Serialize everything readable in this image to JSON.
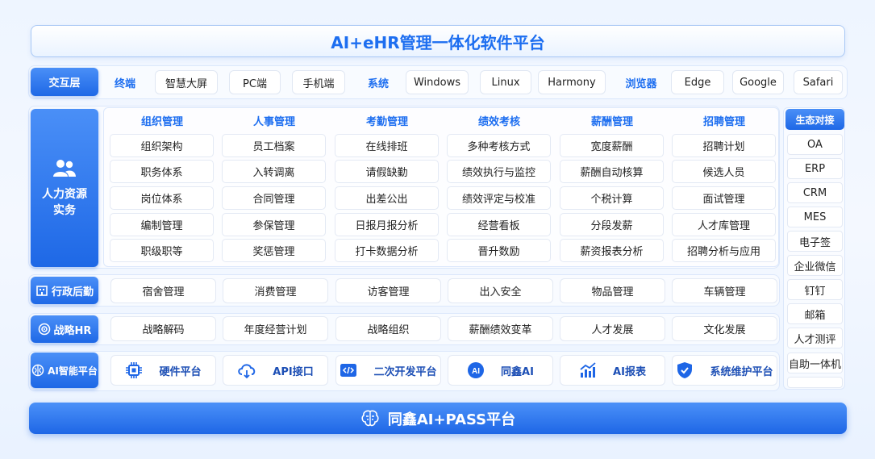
{
  "title": "AI+eHR管理一体化软件平台",
  "interaction": {
    "label": "交互层",
    "items": [
      {
        "text": "终端",
        "header": true
      },
      {
        "text": "智慧大屏"
      },
      {
        "text": "PC端"
      },
      {
        "text": "手机端"
      },
      {
        "text": "系统",
        "header": true
      },
      {
        "text": "Windows"
      },
      {
        "text": "Linux"
      },
      {
        "text": "Harmony"
      },
      {
        "text": "浏览器",
        "header": true
      },
      {
        "text": "Edge"
      },
      {
        "text": "Google"
      },
      {
        "text": "Safari"
      }
    ]
  },
  "hr": {
    "label_line1": "人力资源",
    "label_line2": "实务",
    "icon": "users-icon",
    "columns": [
      {
        "head": "组织管理",
        "items": [
          "组织架构",
          "职务体系",
          "岗位体系",
          "编制管理",
          "职级职等"
        ]
      },
      {
        "head": "人事管理",
        "items": [
          "员工档案",
          "入转调离",
          "合同管理",
          "参保管理",
          "奖惩管理"
        ]
      },
      {
        "head": "考勤管理",
        "items": [
          "在线排班",
          "请假缺勤",
          "出差公出",
          "日报月报分析",
          "打卡数据分析"
        ]
      },
      {
        "head": "绩效考核",
        "items": [
          "多种考核方式",
          "绩效执行与监控",
          "绩效评定与校准",
          "经营看板",
          "晋升数励"
        ]
      },
      {
        "head": "薪酬管理",
        "items": [
          "宽度薪酬",
          "薪酬自动核算",
          "个税计算",
          "分段发薪",
          "薪资报表分析"
        ]
      },
      {
        "head": "招聘管理",
        "items": [
          "招聘计划",
          "候选人员",
          "面试管理",
          "人才库管理",
          "招聘分析与应用"
        ]
      }
    ]
  },
  "admin": {
    "label": "行政后勤",
    "icon": "building-icon",
    "items": [
      "宿舍管理",
      "消费管理",
      "访客管理",
      "出入安全",
      "物品管理",
      "车辆管理"
    ]
  },
  "strategy": {
    "label": "战略HR",
    "icon": "target-icon",
    "items": [
      "战略解码",
      "年度经营计划",
      "战略组织",
      "薪酬绩效变革",
      "人才发展",
      "文化发展"
    ]
  },
  "ai": {
    "label": "AI智能平台",
    "icon": "ai-brain-icon",
    "items": [
      {
        "text": "硬件平台",
        "icon": "chip-icon"
      },
      {
        "text": "API接口",
        "icon": "cloud-api-icon"
      },
      {
        "text": "二次开发平台",
        "icon": "code-icon"
      },
      {
        "text": "同鑫AI",
        "icon": "ai-badge-icon"
      },
      {
        "text": "AI报表",
        "icon": "chart-icon"
      },
      {
        "text": "系统维护平台",
        "icon": "shield-icon"
      }
    ]
  },
  "ecosystem": {
    "head": "生态对接",
    "items": [
      "OA",
      "ERP",
      "CRM",
      "MES",
      "电子签",
      "企业微信",
      "钉钉",
      "邮箱",
      "人才测评",
      "自助一体机"
    ]
  },
  "footer": {
    "text": "同鑫AI+PASS平台",
    "icon": "brain-icon"
  },
  "colors": {
    "accent": "#1d6ef0",
    "label_bg": "#2f78ee"
  }
}
